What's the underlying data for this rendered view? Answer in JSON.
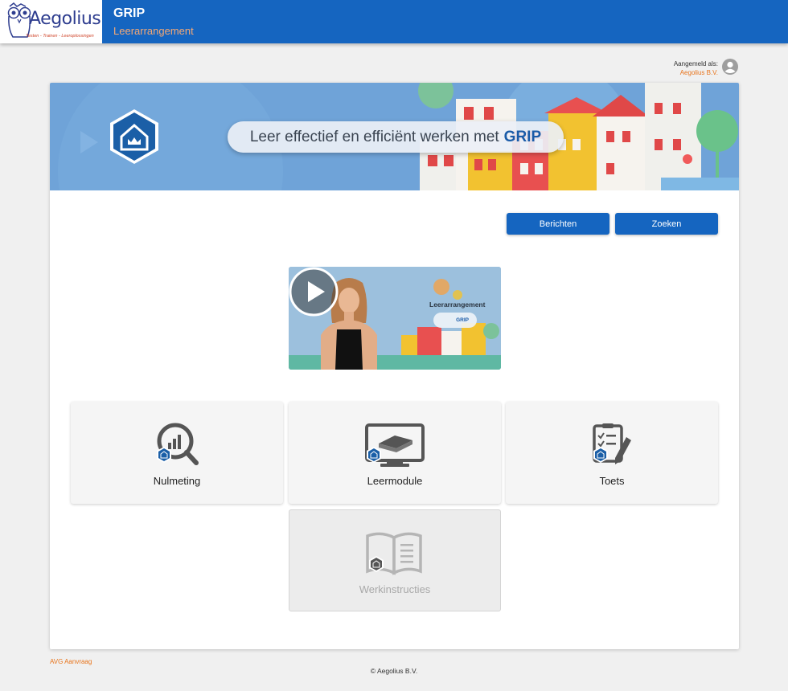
{
  "header": {
    "logo_text": "Aegolius",
    "logo_tagline": "Testen - Trainen - Leeroplossingen",
    "app_title": "GRIP",
    "app_subtitle": "Leerarrangement"
  },
  "user": {
    "label": "Aangemeld als:",
    "name": "Aegolius B.V."
  },
  "banner": {
    "text": "Leer effectief en efficiënt werken met",
    "brand": "GRIP"
  },
  "actions": {
    "messages_label": "Berichten",
    "search_label": "Zoeken"
  },
  "video": {
    "title": "Leerarrangement",
    "chip_label": "GRIP"
  },
  "tiles": [
    {
      "label": "Nulmeting",
      "icon": "magnifier-chart-icon",
      "enabled": true
    },
    {
      "label": "Leermodule",
      "icon": "monitor-book-icon",
      "enabled": true
    },
    {
      "label": "Toets",
      "icon": "checklist-pencil-icon",
      "enabled": true
    },
    {
      "label": "Werkinstructies",
      "icon": "open-book-icon",
      "enabled": false
    }
  ],
  "footer": {
    "avg_link": "AVG Aanvraag",
    "copyright": "© Aegolius B.V."
  },
  "colors": {
    "primary": "#1565c0",
    "accent": "#e8731a",
    "banner_bg": "#6fa3d8"
  }
}
